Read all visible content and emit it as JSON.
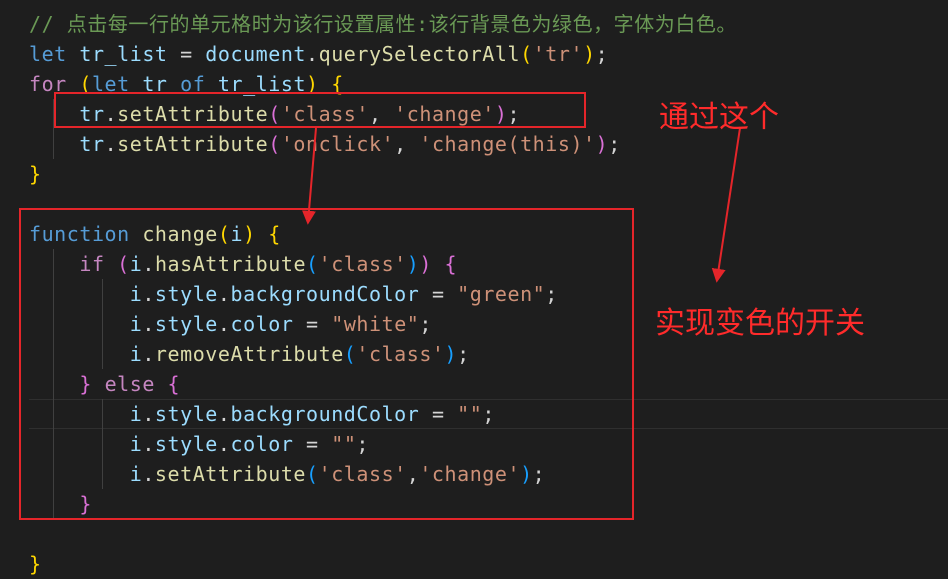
{
  "colors": {
    "background": "#1e1e1e",
    "comment": "#6a9955",
    "keyword": "#569cd6",
    "control": "#c586c0",
    "variable": "#9cdcfe",
    "function": "#dcdcaa",
    "string": "#ce9178",
    "plain": "#d4d4d4",
    "bracket1": "#ffd700",
    "bracket2": "#da70d6",
    "bracket3": "#179fff",
    "annotation": "#ff2b2b"
  },
  "code": [
    [
      {
        "t": "// 点击每一行的单元格时为该行设置属性:该行背景色为绿色，字体为白色。",
        "c": "comment"
      }
    ],
    [
      {
        "t": "let",
        "c": "keyword"
      },
      {
        "t": " ",
        "c": "plain"
      },
      {
        "t": "tr_list",
        "c": "variable"
      },
      {
        "t": " = ",
        "c": "plain"
      },
      {
        "t": "document",
        "c": "variable"
      },
      {
        "t": ".",
        "c": "plain"
      },
      {
        "t": "querySelectorAll",
        "c": "function"
      },
      {
        "t": "(",
        "c": "bracket1"
      },
      {
        "t": "'tr'",
        "c": "string"
      },
      {
        "t": ")",
        "c": "bracket1"
      },
      {
        "t": ";",
        "c": "plain"
      }
    ],
    [
      {
        "t": "for",
        "c": "control"
      },
      {
        "t": " ",
        "c": "plain"
      },
      {
        "t": "(",
        "c": "bracket1"
      },
      {
        "t": "let",
        "c": "keyword"
      },
      {
        "t": " ",
        "c": "plain"
      },
      {
        "t": "tr",
        "c": "variable"
      },
      {
        "t": " ",
        "c": "plain"
      },
      {
        "t": "of",
        "c": "keyword"
      },
      {
        "t": " ",
        "c": "plain"
      },
      {
        "t": "tr_list",
        "c": "variable"
      },
      {
        "t": ")",
        "c": "bracket1"
      },
      {
        "t": " ",
        "c": "plain"
      },
      {
        "t": "{",
        "c": "bracket1"
      }
    ],
    [
      {
        "t": "    ",
        "c": "plain"
      },
      {
        "t": "tr",
        "c": "variable"
      },
      {
        "t": ".",
        "c": "plain"
      },
      {
        "t": "setAttribute",
        "c": "function"
      },
      {
        "t": "(",
        "c": "bracket2"
      },
      {
        "t": "'class'",
        "c": "string"
      },
      {
        "t": ", ",
        "c": "plain"
      },
      {
        "t": "'change'",
        "c": "string"
      },
      {
        "t": ")",
        "c": "bracket2"
      },
      {
        "t": ";",
        "c": "plain"
      }
    ],
    [
      {
        "t": "    ",
        "c": "plain"
      },
      {
        "t": "tr",
        "c": "variable"
      },
      {
        "t": ".",
        "c": "plain"
      },
      {
        "t": "setAttribute",
        "c": "function"
      },
      {
        "t": "(",
        "c": "bracket2"
      },
      {
        "t": "'onclick'",
        "c": "string"
      },
      {
        "t": ", ",
        "c": "plain"
      },
      {
        "t": "'change(this)'",
        "c": "string"
      },
      {
        "t": ")",
        "c": "bracket2"
      },
      {
        "t": ";",
        "c": "plain"
      }
    ],
    [
      {
        "t": "}",
        "c": "bracket1"
      }
    ],
    [],
    [
      {
        "t": "function",
        "c": "keyword"
      },
      {
        "t": " ",
        "c": "plain"
      },
      {
        "t": "change",
        "c": "function"
      },
      {
        "t": "(",
        "c": "bracket1"
      },
      {
        "t": "i",
        "c": "variable"
      },
      {
        "t": ")",
        "c": "bracket1"
      },
      {
        "t": " ",
        "c": "plain"
      },
      {
        "t": "{",
        "c": "bracket1"
      }
    ],
    [
      {
        "t": "    ",
        "c": "plain"
      },
      {
        "t": "if",
        "c": "control"
      },
      {
        "t": " ",
        "c": "plain"
      },
      {
        "t": "(",
        "c": "bracket2"
      },
      {
        "t": "i",
        "c": "variable"
      },
      {
        "t": ".",
        "c": "plain"
      },
      {
        "t": "hasAttribute",
        "c": "function"
      },
      {
        "t": "(",
        "c": "bracket3"
      },
      {
        "t": "'class'",
        "c": "string"
      },
      {
        "t": ")",
        "c": "bracket3"
      },
      {
        "t": ")",
        "c": "bracket2"
      },
      {
        "t": " ",
        "c": "plain"
      },
      {
        "t": "{",
        "c": "bracket2"
      }
    ],
    [
      {
        "t": "        ",
        "c": "plain"
      },
      {
        "t": "i",
        "c": "variable"
      },
      {
        "t": ".",
        "c": "plain"
      },
      {
        "t": "style",
        "c": "variable"
      },
      {
        "t": ".",
        "c": "plain"
      },
      {
        "t": "backgroundColor",
        "c": "variable"
      },
      {
        "t": " = ",
        "c": "plain"
      },
      {
        "t": "\"green\"",
        "c": "string"
      },
      {
        "t": ";",
        "c": "plain"
      }
    ],
    [
      {
        "t": "        ",
        "c": "plain"
      },
      {
        "t": "i",
        "c": "variable"
      },
      {
        "t": ".",
        "c": "plain"
      },
      {
        "t": "style",
        "c": "variable"
      },
      {
        "t": ".",
        "c": "plain"
      },
      {
        "t": "color",
        "c": "variable"
      },
      {
        "t": " = ",
        "c": "plain"
      },
      {
        "t": "\"white\"",
        "c": "string"
      },
      {
        "t": ";",
        "c": "plain"
      }
    ],
    [
      {
        "t": "        ",
        "c": "plain"
      },
      {
        "t": "i",
        "c": "variable"
      },
      {
        "t": ".",
        "c": "plain"
      },
      {
        "t": "removeAttribute",
        "c": "function"
      },
      {
        "t": "(",
        "c": "bracket3"
      },
      {
        "t": "'class'",
        "c": "string"
      },
      {
        "t": ")",
        "c": "bracket3"
      },
      {
        "t": ";",
        "c": "plain"
      }
    ],
    [
      {
        "t": "    ",
        "c": "plain"
      },
      {
        "t": "}",
        "c": "bracket2"
      },
      {
        "t": " ",
        "c": "plain"
      },
      {
        "t": "else",
        "c": "control"
      },
      {
        "t": " ",
        "c": "plain"
      },
      {
        "t": "{",
        "c": "bracket2"
      }
    ],
    [
      {
        "t": "        ",
        "c": "plain"
      },
      {
        "t": "i",
        "c": "variable"
      },
      {
        "t": ".",
        "c": "plain"
      },
      {
        "t": "style",
        "c": "variable"
      },
      {
        "t": ".",
        "c": "plain"
      },
      {
        "t": "backgroundColor",
        "c": "variable"
      },
      {
        "t": " = ",
        "c": "plain"
      },
      {
        "t": "\"\"",
        "c": "string"
      },
      {
        "t": ";",
        "c": "plain"
      }
    ],
    [
      {
        "t": "        ",
        "c": "plain"
      },
      {
        "t": "i",
        "c": "variable"
      },
      {
        "t": ".",
        "c": "plain"
      },
      {
        "t": "style",
        "c": "variable"
      },
      {
        "t": ".",
        "c": "plain"
      },
      {
        "t": "color",
        "c": "variable"
      },
      {
        "t": " = ",
        "c": "plain"
      },
      {
        "t": "\"\"",
        "c": "string"
      },
      {
        "t": ";",
        "c": "plain"
      }
    ],
    [
      {
        "t": "        ",
        "c": "plain"
      },
      {
        "t": "i",
        "c": "variable"
      },
      {
        "t": ".",
        "c": "plain"
      },
      {
        "t": "setAttribute",
        "c": "function"
      },
      {
        "t": "(",
        "c": "bracket3"
      },
      {
        "t": "'class'",
        "c": "string"
      },
      {
        "t": ",",
        "c": "plain"
      },
      {
        "t": "'change'",
        "c": "string"
      },
      {
        "t": ")",
        "c": "bracket3"
      },
      {
        "t": ";",
        "c": "plain"
      }
    ],
    [
      {
        "t": "    ",
        "c": "plain"
      },
      {
        "t": "}",
        "c": "bracket2"
      }
    ],
    [],
    [
      {
        "t": "}",
        "c": "bracket1"
      }
    ]
  ],
  "annotations": {
    "through_this": "通过这个",
    "color_switch": "实现变色的开关"
  }
}
